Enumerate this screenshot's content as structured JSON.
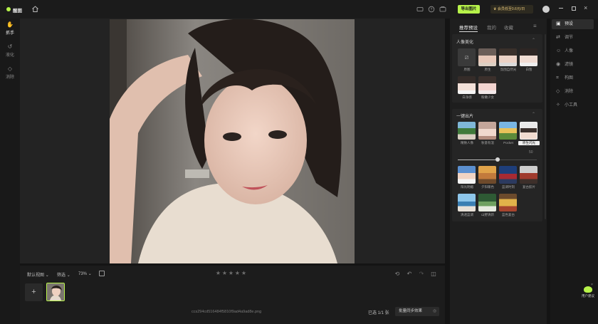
{
  "app": {
    "name": "醒图"
  },
  "titlebar": {
    "export_label": "导出图片",
    "vip_label": "会员低至0.6元/日"
  },
  "left_tools": [
    {
      "label": "抓手",
      "icon": "hand-icon"
    },
    {
      "label": "液化",
      "icon": "liquify-icon"
    },
    {
      "label": "消除",
      "icon": "eraser-icon"
    }
  ],
  "bottom": {
    "view_label": "默认视图",
    "filter_label": "筛选",
    "zoom_label": "73%",
    "rating_stars": 5,
    "filename": "ccs294cd516484f5810f9ad4a9ad8e.png",
    "selected_count": "已选 1/1 张",
    "sync_label": "批量同步效果"
  },
  "right_panel": {
    "tabs": [
      "推荐预设",
      "我的",
      "收藏"
    ],
    "section1": {
      "title": "人像美化",
      "items": [
        "原图",
        "原生",
        "氛围自然光",
        "白皙",
        "白净感",
        "粉嫩少女"
      ]
    },
    "section2": {
      "title": "一键出片",
      "items": [
        "精致人像",
        "秋意有温",
        "Pocket",
        "原生闪光",
        "阳光明媚",
        "夕阳暖色",
        "蓝调时刻",
        "复古胶片",
        "清透蓝调",
        "山野清新",
        "蓝色复古"
      ],
      "slider_value": "50",
      "slider_fraction": 0.5
    }
  },
  "right_nav": [
    {
      "label": "预设",
      "icon": "preset-icon"
    },
    {
      "label": "调节",
      "icon": "adjust-icon"
    },
    {
      "label": "人像",
      "icon": "portrait-icon"
    },
    {
      "label": "滤镜",
      "icon": "filter-icon"
    },
    {
      "label": "构图",
      "icon": "crop-icon"
    },
    {
      "label": "消除",
      "icon": "erase-icon"
    },
    {
      "label": "小工具",
      "icon": "tools-icon"
    }
  ],
  "feedback": {
    "label": "用户建议"
  },
  "colors": {
    "accent": "#b7f34a",
    "panel": "#1e1e1e",
    "background": "#141414"
  }
}
